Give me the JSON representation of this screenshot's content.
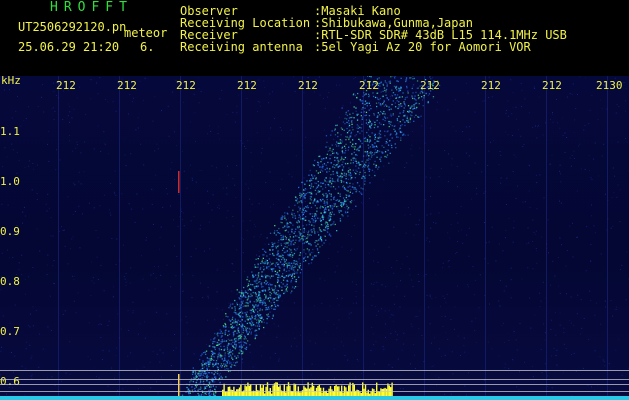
{
  "brand": "HROFFT",
  "file_name": "UT2506292120.pn",
  "event_type": "meteor",
  "date_time": "25.06.29 21:20",
  "counter": "6.",
  "info": [
    {
      "label": "Observer",
      "value": ":Masaki Kano"
    },
    {
      "label": "Receiving Location",
      "value": ":Shibukawa,Gunma,Japan"
    },
    {
      "label": "Receiver",
      "value": ":RTL-SDR SDR# 43dB L15 114.1MHz USB"
    },
    {
      "label": "Receiving antenna",
      "value": ":5el Yagi Az 20 for Aomori VOR"
    }
  ],
  "axis": {
    "y_unit": "kHz",
    "y_ticks": [
      "1.1",
      "1.0",
      "0.9",
      "0.8",
      "0.7",
      "0.6"
    ],
    "x_ticks": [
      "212",
      "212",
      "212",
      "212",
      "212",
      "212",
      "212",
      "212",
      "212",
      "2130"
    ]
  },
  "colors": {
    "text": "#f2f24a",
    "brand": "#2fe03a",
    "background": "#05083a",
    "signal": "#27c9e6",
    "burst": "#ffff33"
  }
}
